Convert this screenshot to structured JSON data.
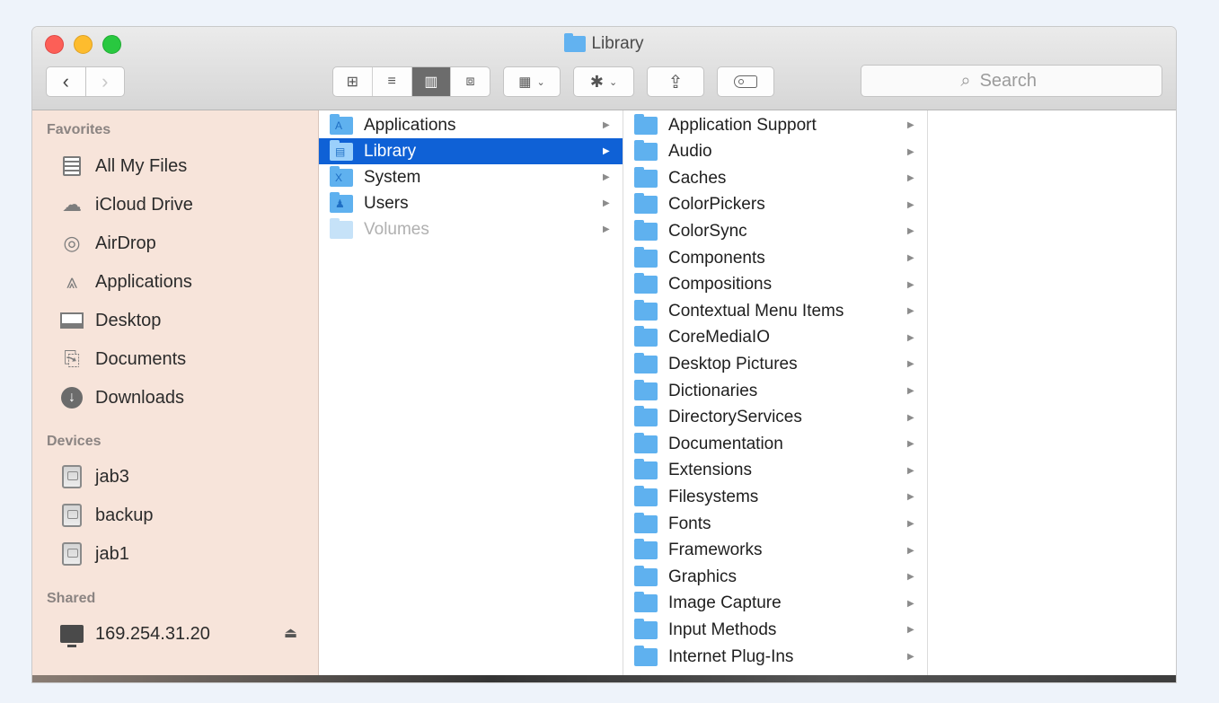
{
  "window": {
    "title": "Library"
  },
  "toolbar": {
    "back_label": "‹",
    "forward_label": "›",
    "view_modes": [
      {
        "label": "⊞",
        "name": "icon-view"
      },
      {
        "label": "≡",
        "name": "list-view"
      },
      {
        "label": "▥",
        "name": "column-view",
        "active": true
      },
      {
        "label": "⧈",
        "name": "cover-flow-view"
      }
    ],
    "arrange_icon": "▦",
    "action_icon": "✱",
    "share_icon": "⇪",
    "search": {
      "placeholder": "Search",
      "icon": "⌕"
    }
  },
  "sidebar": {
    "favorites_header": "Favorites",
    "favorites": [
      {
        "label": "All My Files",
        "icon": "all-my-files-icon"
      },
      {
        "label": "iCloud Drive",
        "icon": "cloud-icon"
      },
      {
        "label": "AirDrop",
        "icon": "airdrop-icon"
      },
      {
        "label": "Applications",
        "icon": "applications-icon"
      },
      {
        "label": "Desktop",
        "icon": "desktop-icon"
      },
      {
        "label": "Documents",
        "icon": "documents-icon"
      },
      {
        "label": "Downloads",
        "icon": "downloads-icon"
      }
    ],
    "devices_header": "Devices",
    "devices": [
      {
        "label": "jab3"
      },
      {
        "label": "backup"
      },
      {
        "label": "jab1"
      }
    ],
    "shared_header": "Shared",
    "shared": [
      {
        "label": "169.254.31.20",
        "eject": "⏏"
      }
    ]
  },
  "column1": {
    "items": [
      {
        "label": "Applications",
        "glyph": "A"
      },
      {
        "label": "Library",
        "glyph": "▤",
        "selected": true
      },
      {
        "label": "System",
        "glyph": "X"
      },
      {
        "label": "Users",
        "glyph": "♟"
      },
      {
        "label": "Volumes",
        "dim": true
      }
    ]
  },
  "column2": {
    "items": [
      "Application Support",
      "Audio",
      "Caches",
      "ColorPickers",
      "ColorSync",
      "Components",
      "Compositions",
      "Contextual Menu Items",
      "CoreMediaIO",
      "Desktop Pictures",
      "Dictionaries",
      "DirectoryServices",
      "Documentation",
      "Extensions",
      "Filesystems",
      "Fonts",
      "Frameworks",
      "Graphics",
      "Image Capture",
      "Input Methods",
      "Internet Plug-Ins"
    ]
  },
  "colors": {
    "selection": "#0f61d6",
    "folder": "#5fb1ef",
    "sidebar_bg": "#f7e4da"
  }
}
